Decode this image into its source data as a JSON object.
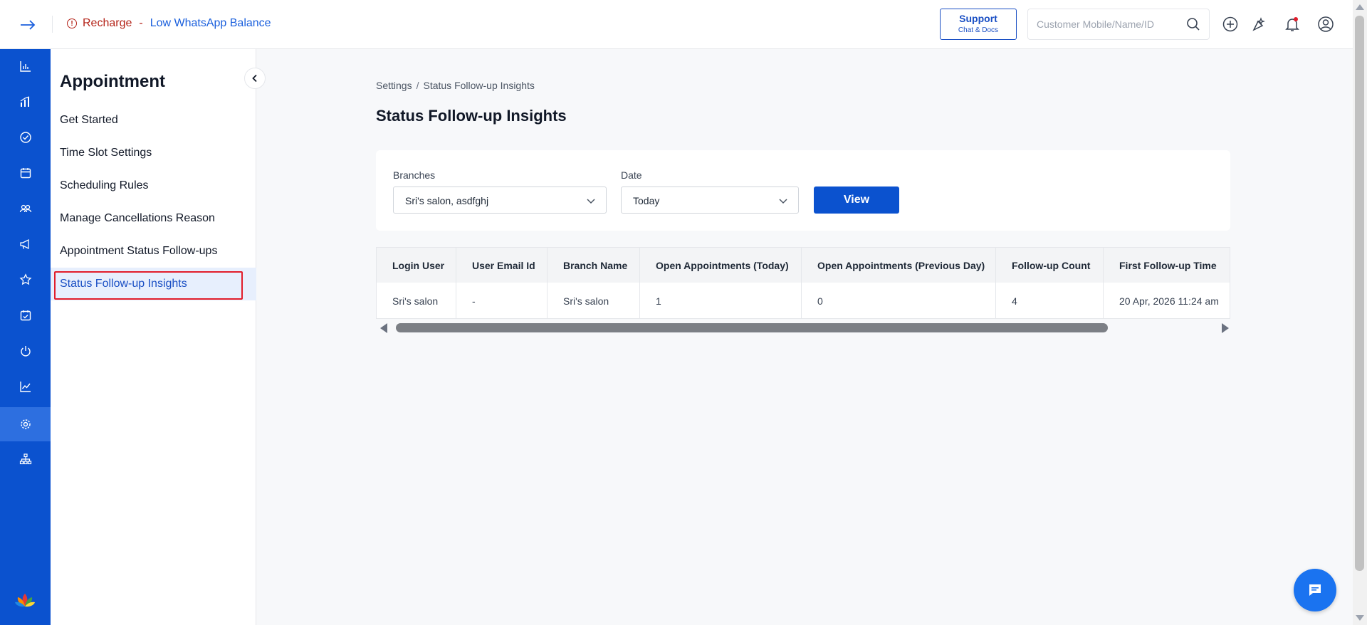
{
  "topbar": {
    "recharge_label": "Recharge",
    "recharge_dash": "-",
    "recharge_link": "Low WhatsApp Balance",
    "support_title": "Support",
    "support_subtitle": "Chat & Docs",
    "search_placeholder": "Customer Mobile/Name/ID"
  },
  "rail": {
    "items": [
      "dashboard-icon",
      "reports-icon",
      "check-circle-icon",
      "calendar-icon",
      "customers-icon",
      "megaphone-icon",
      "star-icon",
      "calendar-check-icon",
      "power-icon",
      "analytics-icon",
      "settings-icon",
      "org-chart-icon"
    ],
    "active": "settings-icon"
  },
  "sidebar": {
    "title": "Appointment",
    "items": [
      {
        "label": "Get Started"
      },
      {
        "label": "Time Slot Settings"
      },
      {
        "label": "Scheduling Rules"
      },
      {
        "label": "Manage Cancellations Reason"
      },
      {
        "label": "Appointment Status Follow-ups"
      },
      {
        "label": "Status Follow-up Insights"
      }
    ],
    "selected": "Status Follow-up Insights"
  },
  "breadcrumb": {
    "parent": "Settings",
    "separator": "/",
    "current": "Status Follow-up Insights"
  },
  "page": {
    "title": "Status Follow-up Insights"
  },
  "filters": {
    "branches_label": "Branches",
    "branches_value": "Sri's salon, asdfghj",
    "date_label": "Date",
    "date_value": "Today",
    "view_label": "View"
  },
  "table": {
    "columns": [
      "Login User",
      "User Email Id",
      "Branch Name",
      "Open Appointments (Today)",
      "Open Appointments (Previous Day)",
      "Follow-up Count",
      "First Follow-up Time"
    ],
    "rows": [
      [
        "Sri's salon",
        "-",
        "Sri's salon",
        "1",
        "0",
        "4",
        "20 Apr, 2026 11:24 am"
      ]
    ]
  },
  "colors": {
    "primary": "#0b52cf",
    "link": "#1a5fdd",
    "alert": "#b42318",
    "highlight": "#e11d2b"
  }
}
